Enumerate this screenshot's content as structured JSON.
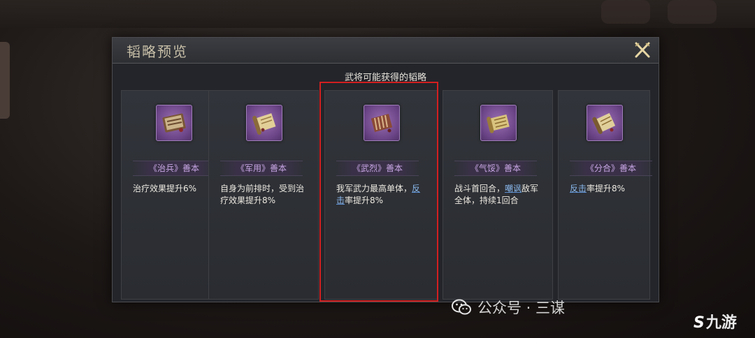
{
  "dialog": {
    "title": "韬略预览",
    "section_title": "武将可能获得的韬略"
  },
  "cards": [
    {
      "name": "《治兵》善本",
      "desc_parts": [
        {
          "t": "治疗效果提升6%"
        }
      ]
    },
    {
      "name": "《军用》善本",
      "desc_parts": [
        {
          "t": "自身为前排时，受到治疗效果提升8%"
        }
      ]
    },
    {
      "name": "《武烈》善本",
      "desc_parts": [
        {
          "t": "我军武力最高单体，"
        },
        {
          "t": "反击",
          "link": true
        },
        {
          "t": "率提升8%"
        }
      ]
    },
    {
      "name": "《气馁》善本",
      "desc_parts": [
        {
          "t": "战斗首回合，"
        },
        {
          "t": "嘲讽",
          "link": true
        },
        {
          "t": "敌军全体，持续1回合"
        }
      ]
    },
    {
      "name": "《分合》善本",
      "desc_parts": [
        {
          "t": "反击",
          "link": true
        },
        {
          "t": "率提升8%"
        }
      ]
    }
  ],
  "watermark": {
    "text": "公众号 · 三谋",
    "icon": "wechat-icon"
  },
  "logo": {
    "mark": "S",
    "text": "九游"
  },
  "colors": {
    "highlight": "#d21f1f",
    "link": "#8ab8ec",
    "name": "#c9a7e6"
  }
}
